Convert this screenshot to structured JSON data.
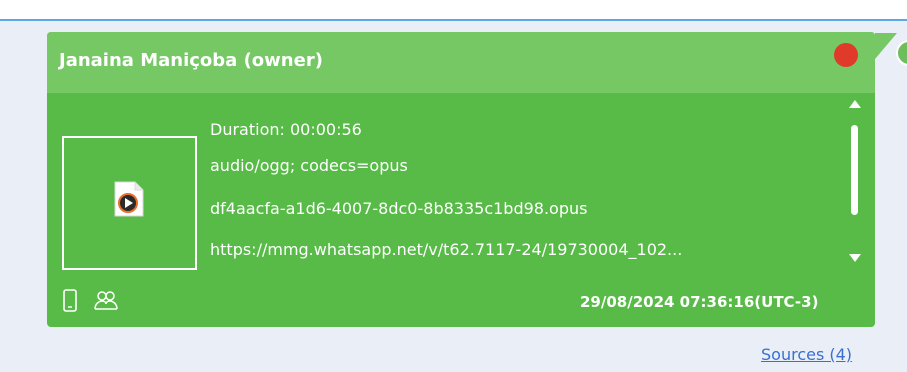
{
  "message": {
    "sender": "Janaina Maniçoba (owner)",
    "duration": "Duration: 00:00:56",
    "mime_type": "audio/ogg; codecs=opus",
    "filename": "df4aacfa-a1d6-4007-8dc0-8b8335c1bd98.opus",
    "url": "https://mmg.whatsapp.net/v/t62.7117-24/19730004_102...",
    "timestamp": "29/08/2024 07:36:16(UTC-3)",
    "bubble_color": "#58bb48",
    "status_dot_color": "#e03a2a",
    "icons": [
      "audio-file-icon",
      "phone-icon",
      "contacts-icon"
    ]
  },
  "footer": {
    "sources_link": "Sources (4)"
  }
}
